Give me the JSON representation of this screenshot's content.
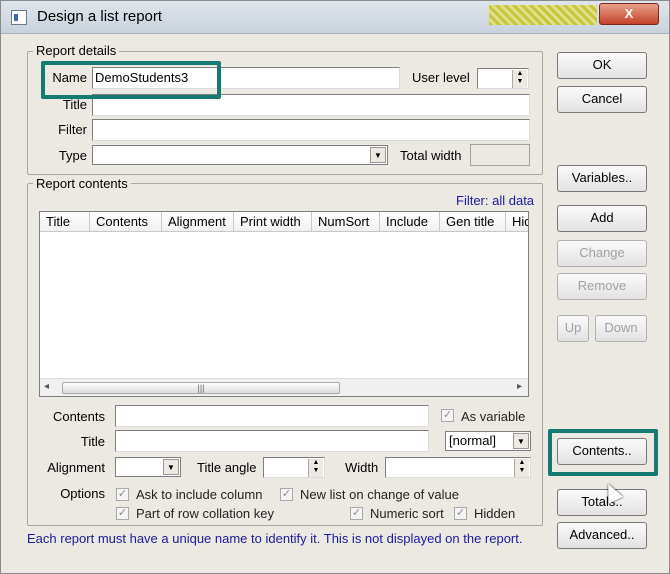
{
  "window": {
    "title": "Design a list report",
    "close_label": "X"
  },
  "report_details": {
    "group_label": "Report details",
    "name_label": "Name",
    "name_value": "DemoStudents3",
    "user_level_label": "User level",
    "title_label": "Title",
    "filter_label": "Filter",
    "type_label": "Type",
    "total_width_label": "Total width"
  },
  "report_contents": {
    "group_label": "Report contents",
    "filter_link": "Filter: all data",
    "columns": [
      "Title",
      "Contents",
      "Alignment",
      "Print width",
      "NumSort",
      "Include",
      "Gen title",
      "Hid"
    ],
    "contents_label": "Contents",
    "as_variable_label": "As variable",
    "title_label": "Title",
    "title_format": "[normal]",
    "alignment_label": "Alignment",
    "title_angle_label": "Title angle",
    "width_label": "Width",
    "options_label": "Options",
    "opt_ask_include": "Ask to  include column",
    "opt_new_list": "New list on change of value",
    "opt_row_collation": "Part of row collation key",
    "opt_numeric_sort": "Numeric sort",
    "opt_hidden": "Hidden",
    "hint": "Each report must have a unique name to identify it. This is not displayed on the report."
  },
  "buttons": {
    "ok": "OK",
    "cancel": "Cancel",
    "variables": "Variables..",
    "add": "Add",
    "change": "Change",
    "remove": "Remove",
    "up": "Up",
    "down": "Down",
    "contents": "Contents..",
    "totals": "Totals..",
    "advanced": "Advanced.."
  },
  "colors": {
    "highlight": "#147a72",
    "link": "#1a1a9a",
    "dialog_bg": "#ece9e3"
  }
}
